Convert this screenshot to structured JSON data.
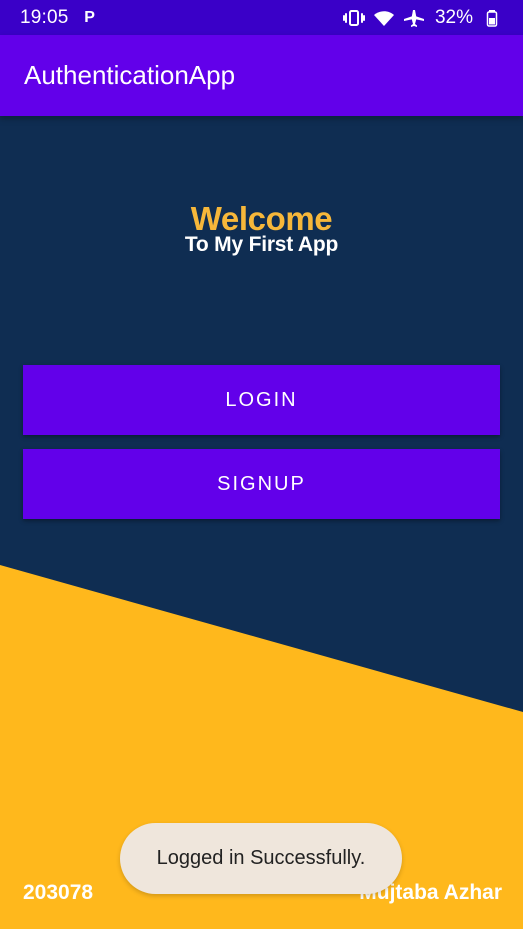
{
  "status_bar": {
    "time": "19:05",
    "app_badge": "P",
    "battery_percent": "32%",
    "icons": [
      "vibrate-icon",
      "wifi-icon",
      "airplane-icon",
      "battery-icon"
    ]
  },
  "app_bar": {
    "title": "AuthenticationApp"
  },
  "hero": {
    "title": "Welcome",
    "subtitle": "To My First App"
  },
  "actions": {
    "login_label": "LOGIN",
    "signup_label": "SIGNUP"
  },
  "footer": {
    "left_text": "203078",
    "right_text": "Mujtaba Azhar"
  },
  "toast": {
    "message": "Logged in Successfully."
  },
  "colors": {
    "status_bar": "#3a00c8",
    "app_bar": "#6200ea",
    "background": "#0f2d52",
    "accent_yellow": "#ffb81c",
    "title_yellow": "#f6b73a",
    "toast_bg": "#efe6dc"
  }
}
